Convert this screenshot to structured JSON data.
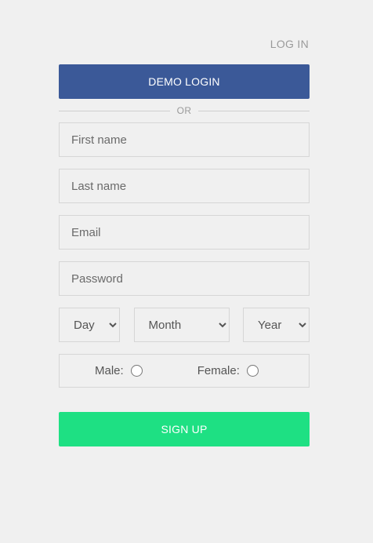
{
  "header": {
    "login_link": "LOG IN"
  },
  "form": {
    "demo_login_label": "DEMO LOGIN",
    "divider_text": "OR",
    "first_name_placeholder": "First name",
    "last_name_placeholder": "Last name",
    "email_placeholder": "Email",
    "password_placeholder": "Password",
    "dob": {
      "day_selected": "Day",
      "month_selected": "Month",
      "year_selected": "Year"
    },
    "gender": {
      "male_label": "Male:",
      "female_label": "Female:"
    },
    "signup_label": "SIGN UP"
  },
  "colors": {
    "demo_button": "#3b5998",
    "signup_button": "#1ee083",
    "background": "#f0f0f0"
  }
}
